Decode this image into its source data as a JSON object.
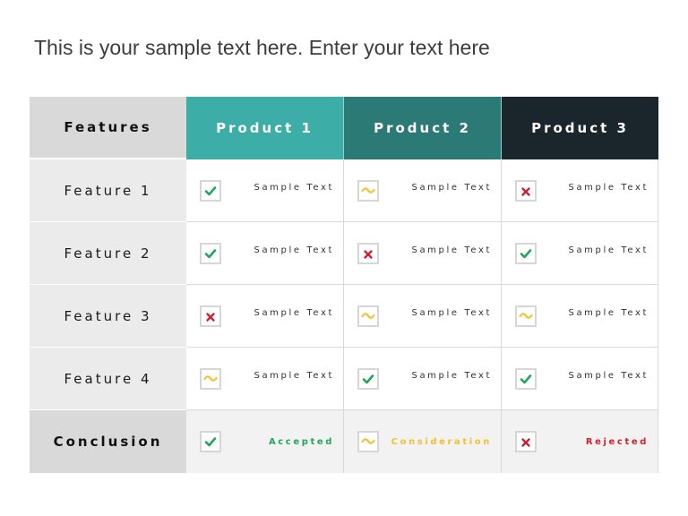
{
  "title": "This is your sample text here. Enter your text here",
  "colors": {
    "product1": "#3cada7",
    "product2": "#2c7a76",
    "product3": "#1b262c",
    "check": "#22a55a",
    "tilde": "#f2c12e",
    "cross": "#d0202e"
  },
  "table": {
    "header": {
      "features": "Features",
      "products": [
        "Product 1",
        "Product 2",
        "Product 3"
      ]
    },
    "rows": [
      {
        "label": "Feature 1",
        "cells": [
          {
            "icon": "check-icon",
            "text": "Sample Text"
          },
          {
            "icon": "tilde-icon",
            "text": "Sample Text"
          },
          {
            "icon": "cross-icon",
            "text": "Sample Text"
          }
        ]
      },
      {
        "label": "Feature 2",
        "cells": [
          {
            "icon": "check-icon",
            "text": "Sample Text"
          },
          {
            "icon": "cross-icon",
            "text": "Sample Text"
          },
          {
            "icon": "check-icon",
            "text": "Sample Text"
          }
        ]
      },
      {
        "label": "Feature 3",
        "cells": [
          {
            "icon": "cross-icon",
            "text": "Sample Text"
          },
          {
            "icon": "tilde-icon",
            "text": "Sample Text"
          },
          {
            "icon": "tilde-icon",
            "text": "Sample Text"
          }
        ]
      },
      {
        "label": "Feature 4",
        "cells": [
          {
            "icon": "tilde-icon",
            "text": "Sample Text"
          },
          {
            "icon": "check-icon",
            "text": "Sample Text"
          },
          {
            "icon": "check-icon",
            "text": "Sample Text"
          }
        ]
      }
    ],
    "conclusion": {
      "label": "Conclusion",
      "cells": [
        {
          "icon": "check-icon",
          "text": "Accepted"
        },
        {
          "icon": "tilde-icon",
          "text": "Consideration"
        },
        {
          "icon": "cross-icon",
          "text": "Rejected"
        }
      ]
    }
  }
}
